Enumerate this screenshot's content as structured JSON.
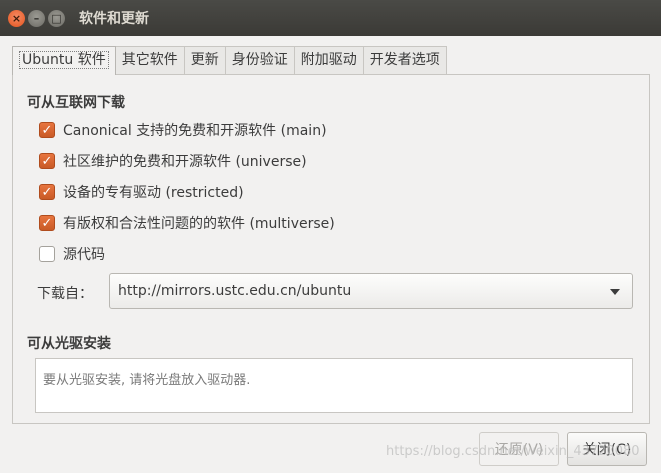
{
  "window": {
    "title": "软件和更新"
  },
  "tabs": [
    {
      "label": "Ubuntu 软件",
      "active": true
    },
    {
      "label": "其它软件"
    },
    {
      "label": "更新"
    },
    {
      "label": "身份验证"
    },
    {
      "label": "附加驱动"
    },
    {
      "label": "开发者选项"
    }
  ],
  "internet": {
    "heading": "可从互联网下载",
    "options": [
      {
        "label": "Canonical 支持的免费和开源软件 (main)",
        "checked": true
      },
      {
        "label": "社区维护的免费和开源软件 (universe)",
        "checked": true
      },
      {
        "label": "设备的专有驱动 (restricted)",
        "checked": true
      },
      {
        "label": "有版权和合法性问题的的软件 (multiverse)",
        "checked": true
      },
      {
        "label": "源代码",
        "checked": false
      }
    ],
    "download_from_label": "下载自：",
    "download_from_value": "http://mirrors.ustc.edu.cn/ubuntu"
  },
  "cdrom": {
    "heading": "可从光驱安装",
    "placeholder": "要从光驱安装, 请将光盘放入驱动器."
  },
  "buttons": {
    "revert": "还原(V)",
    "close": "关闭(C)"
  },
  "watermark": "https://blog.csdn.net/weixin_43720080",
  "colors": {
    "accent": "#e05f26",
    "titlebar": "#3b3a36"
  }
}
